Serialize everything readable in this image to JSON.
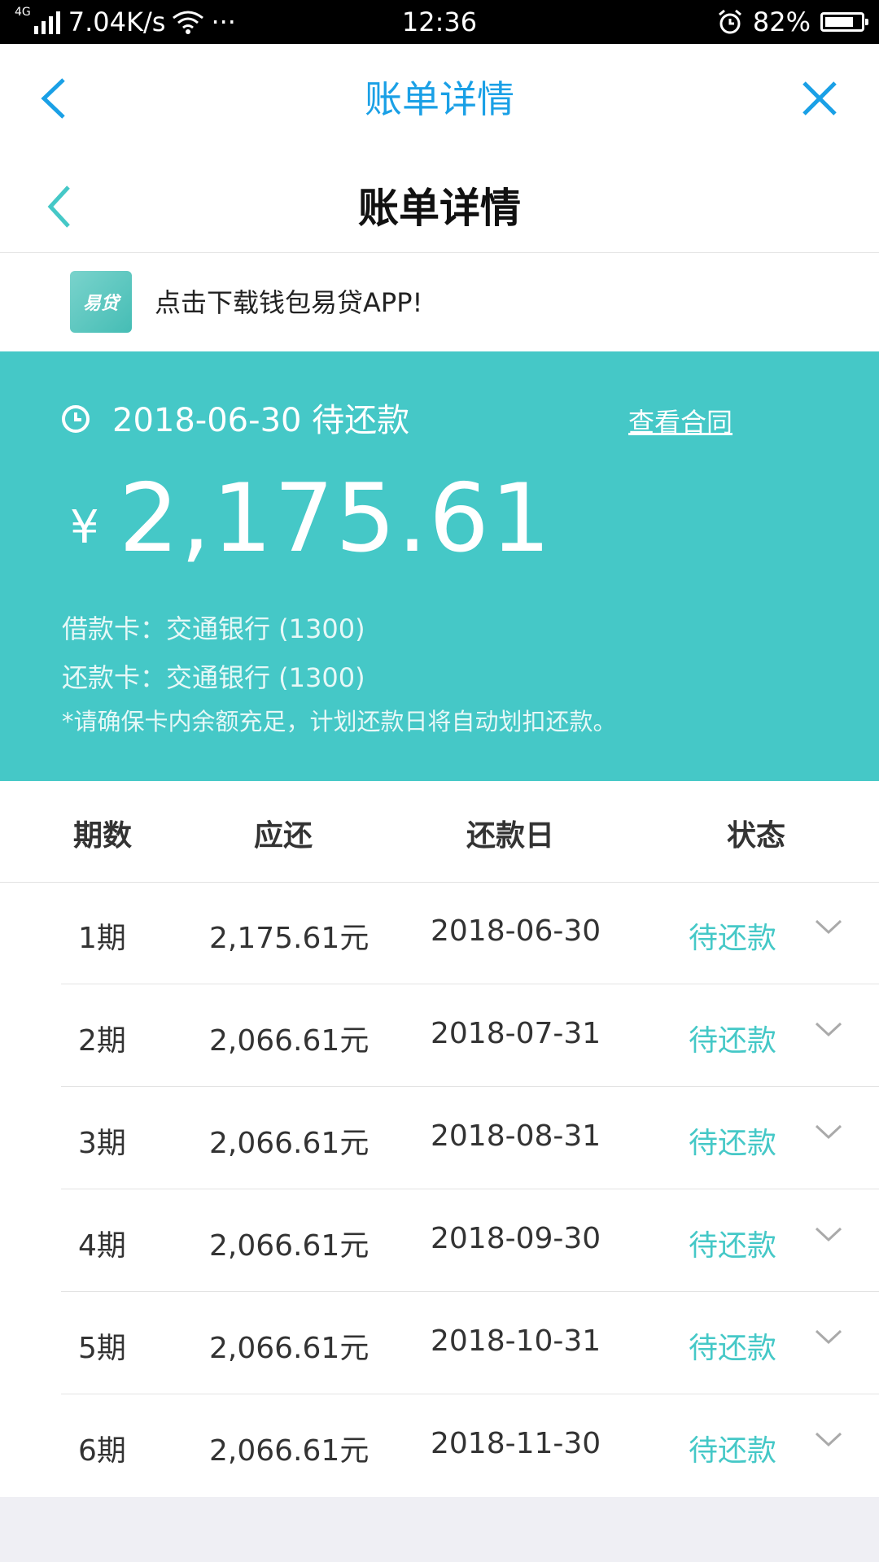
{
  "status_bar": {
    "network": "4G",
    "speed": "7.04K/s",
    "more": "···",
    "time": "12:36",
    "battery": "82%",
    "battery_level": 0.82
  },
  "web_nav": {
    "title": "账单详情"
  },
  "app_header": {
    "title": "账单详情"
  },
  "promo": {
    "logo_text": "易贷",
    "text": "点击下载钱包易贷APP!"
  },
  "summary": {
    "due_text": "2018-06-30 待还款",
    "contract_link": "查看合同",
    "currency": "¥",
    "amount": "2,175.61",
    "loan_card": "借款卡：交通银行 (1300)",
    "repay_card": "还款卡：交通银行 (1300)",
    "note": "*请确保卡内余额充足，计划还款日将自动划扣还款。"
  },
  "table": {
    "headers": [
      "期数",
      "应还",
      "还款日",
      "状态"
    ],
    "rows": [
      {
        "period": "1期",
        "amount": "2,175.61元",
        "date": "2018-06-30",
        "status": "待还款"
      },
      {
        "period": "2期",
        "amount": "2,066.61元",
        "date": "2018-07-31",
        "status": "待还款"
      },
      {
        "period": "3期",
        "amount": "2,066.61元",
        "date": "2018-08-31",
        "status": "待还款"
      },
      {
        "period": "4期",
        "amount": "2,066.61元",
        "date": "2018-09-30",
        "status": "待还款"
      },
      {
        "period": "5期",
        "amount": "2,066.61元",
        "date": "2018-10-31",
        "status": "待还款"
      },
      {
        "period": "6期",
        "amount": "2,066.61元",
        "date": "2018-11-30",
        "status": "待还款"
      }
    ]
  },
  "colors": {
    "accent": "#45c8c7",
    "nav_blue": "#1aa0e6"
  }
}
